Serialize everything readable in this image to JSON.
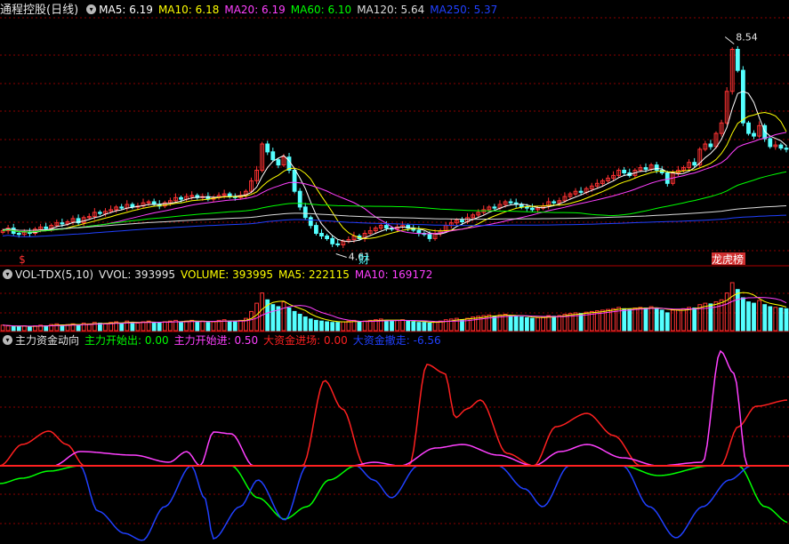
{
  "header": {
    "stock_title": "通程控股(日线)",
    "ma": [
      {
        "label": "MA5: 6.19",
        "color": "#ffffff"
      },
      {
        "label": "MA10: 6.18",
        "color": "#ffff00"
      },
      {
        "label": "MA20: 6.19",
        "color": "#ff40ff"
      },
      {
        "label": "MA60: 6.10",
        "color": "#00ff00"
      },
      {
        "label": "MA120: 5.64",
        "color": "#dcdcdc"
      },
      {
        "label": "MA250: 5.37",
        "color": "#2040ff"
      }
    ]
  },
  "volume_header": {
    "name": "VOL-TDX(5,10)",
    "items": [
      {
        "label": "VVOL: 393995",
        "color": "#e6e6e6"
      },
      {
        "label": "VOLUME: 393995",
        "color": "#ffff00"
      },
      {
        "label": "MA5: 222115",
        "color": "#ffff00"
      },
      {
        "label": "MA10: 169172",
        "color": "#ff40ff"
      }
    ]
  },
  "flow_header": {
    "name": "主力资金动向",
    "items": [
      {
        "label": "主力开始出: 0.00",
        "color": "#00ff00"
      },
      {
        "label": "主力开始进: 0.50",
        "color": "#ff40ff"
      },
      {
        "label": "大资金进场: 0.00",
        "color": "#ff2020"
      },
      {
        "label": "大资金撤走: -6.56",
        "color": "#2040ff"
      }
    ]
  },
  "colors": {
    "up": "#ff3232",
    "down": "#54ffff",
    "grid": "#8b0000",
    "axis": "#8b0000"
  },
  "chart_data": [
    {
      "type": "candlestick",
      "pane": "price",
      "ylim": [
        4.3,
        9.0
      ],
      "closes": [
        4.95,
        5.0,
        4.9,
        4.88,
        4.92,
        4.9,
        4.98,
        5.02,
        4.99,
        5.05,
        5.1,
        5.08,
        5.12,
        5.18,
        5.1,
        5.2,
        5.22,
        5.3,
        5.28,
        5.32,
        5.35,
        5.4,
        5.38,
        5.45,
        5.4,
        5.42,
        5.48,
        5.5,
        5.45,
        5.42,
        5.48,
        5.52,
        5.58,
        5.55,
        5.6,
        5.62,
        5.58,
        5.6,
        5.55,
        5.58,
        5.62,
        5.65,
        5.6,
        5.58,
        5.62,
        5.7,
        5.9,
        6.1,
        6.6,
        6.45,
        6.3,
        6.2,
        6.35,
        6.1,
        5.7,
        5.4,
        5.2,
        5.05,
        4.9,
        4.85,
        4.8,
        4.7,
        4.68,
        4.75,
        4.78,
        4.85,
        4.8,
        4.9,
        4.95,
        5.0,
        5.05,
        5.0,
        4.98,
        5.02,
        5.05,
        5.0,
        4.96,
        4.9,
        4.88,
        4.8,
        4.9,
        4.95,
        5.05,
        5.1,
        5.15,
        5.12,
        5.2,
        5.25,
        5.3,
        5.35,
        5.4,
        5.38,
        5.45,
        5.5,
        5.48,
        5.45,
        5.4,
        5.38,
        5.35,
        5.38,
        5.42,
        5.5,
        5.48,
        5.52,
        5.6,
        5.65,
        5.7,
        5.68,
        5.75,
        5.8,
        5.85,
        5.9,
        5.95,
        6.0,
        6.1,
        6.05,
        6.0,
        6.1,
        6.15,
        6.12,
        6.2,
        6.1,
        6.05,
        5.85,
        6.05,
        6.1,
        6.15,
        6.25,
        6.2,
        6.5,
        6.6,
        6.55,
        6.8,
        7.0,
        7.6,
        8.4,
        8.0,
        7.0,
        6.8,
        6.75,
        6.95,
        6.7,
        6.55,
        6.58,
        6.52,
        6.5
      ],
      "annotations": [
        {
          "label": "8.54",
          "kind": "high"
        },
        {
          "label": "4.61",
          "kind": "low"
        }
      ],
      "markers": [
        "$",
        "财",
        "龙虎榜"
      ]
    },
    {
      "type": "bar",
      "pane": "volume",
      "values": [
        8,
        7,
        6,
        6,
        7,
        6,
        7,
        8,
        7,
        9,
        10,
        8,
        9,
        10,
        8,
        11,
        10,
        12,
        11,
        10,
        12,
        13,
        11,
        14,
        12,
        11,
        13,
        14,
        12,
        11,
        13,
        14,
        15,
        13,
        14,
        15,
        13,
        14,
        12,
        13,
        15,
        16,
        14,
        13,
        15,
        18,
        28,
        40,
        55,
        45,
        38,
        35,
        42,
        33,
        28,
        24,
        20,
        17,
        15,
        14,
        13,
        12,
        12,
        13,
        14,
        15,
        13,
        14,
        15,
        16,
        17,
        15,
        14,
        15,
        16,
        14,
        13,
        12,
        12,
        11,
        13,
        14,
        16,
        17,
        18,
        16,
        18,
        20,
        21,
        22,
        23,
        21,
        23,
        24,
        22,
        21,
        20,
        19,
        18,
        19,
        20,
        22,
        21,
        22,
        24,
        25,
        26,
        25,
        27,
        28,
        29,
        30,
        31,
        32,
        34,
        32,
        31,
        33,
        34,
        33,
        35,
        32,
        30,
        26,
        30,
        31,
        32,
        34,
        33,
        38,
        40,
        39,
        42,
        45,
        55,
        70,
        60,
        48,
        42,
        40,
        44,
        38,
        35,
        34,
        33,
        32
      ]
    },
    {
      "type": "line",
      "pane": "flow",
      "ylim": [
        -10,
        20
      ],
      "series": [
        {
          "name": "主力开始出",
          "color": "#00ff00"
        },
        {
          "name": "主力开始进",
          "color": "#ff40ff"
        },
        {
          "name": "大资金进场",
          "color": "#ff2020"
        },
        {
          "name": "大资金撤走",
          "color": "#2040ff"
        }
      ]
    }
  ]
}
